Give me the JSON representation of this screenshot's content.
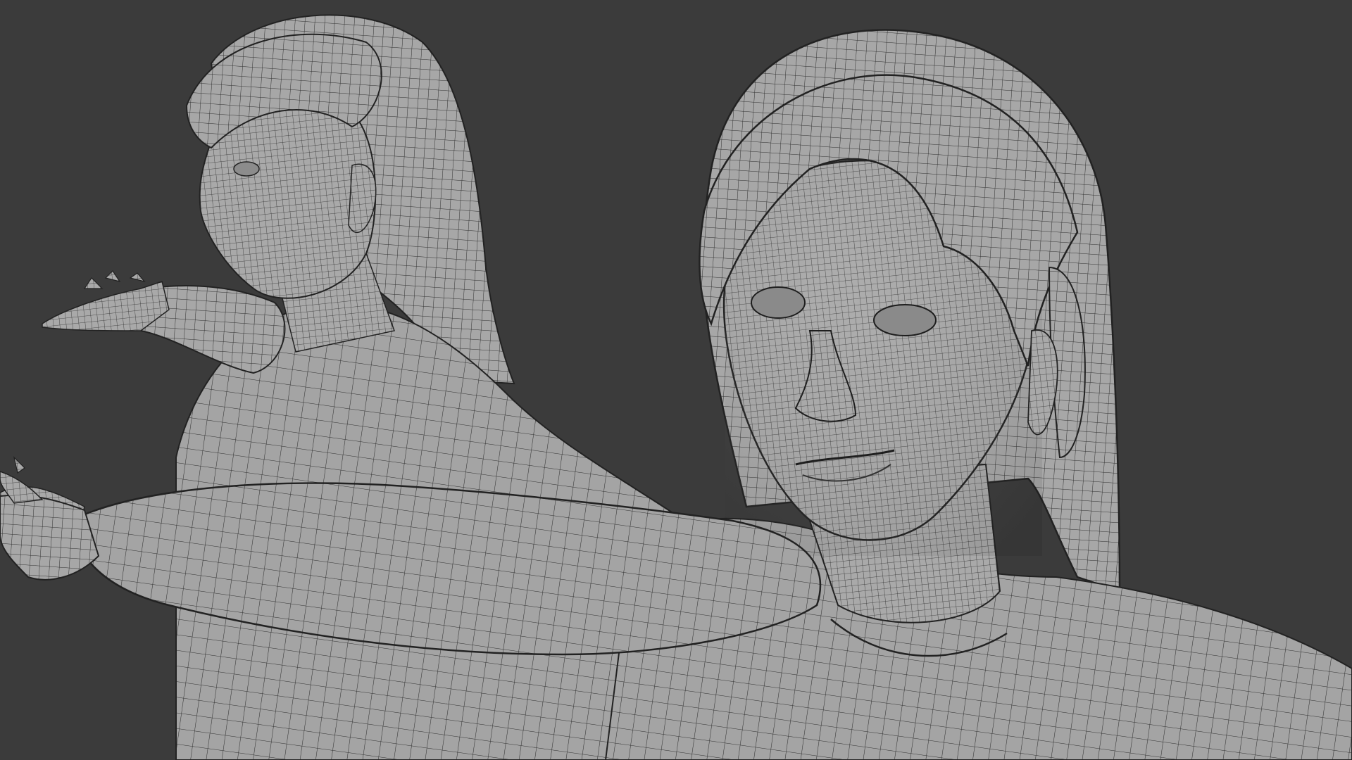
{
  "scene": {
    "background_color": "#3b3b3b",
    "mesh_color": "#a6a6a6",
    "wire_color": "#2f2f2f",
    "objects": [
      {
        "name": "character-mesh-side-view",
        "icon": "wireframe-figure"
      },
      {
        "name": "character-mesh-front-view",
        "icon": "wireframe-figure"
      }
    ]
  }
}
